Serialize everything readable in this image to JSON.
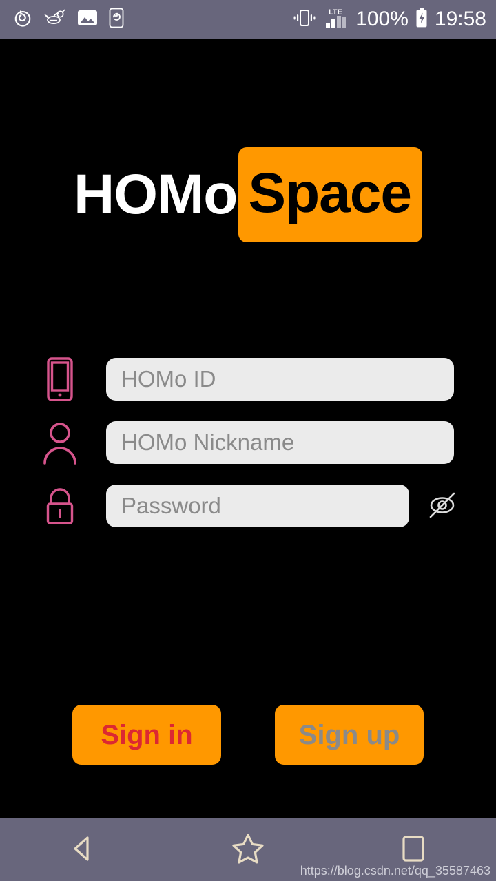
{
  "status_bar": {
    "background": "#68667c",
    "left_icons": [
      {
        "name": "netease-music-icon"
      },
      {
        "name": "bee-icon"
      },
      {
        "name": "gallery-photo-icon"
      },
      {
        "name": "screen-rotate-icon"
      }
    ],
    "right_icons": [
      {
        "name": "vibrate-icon"
      },
      {
        "name": "lte-signal-icon",
        "label": "LTE"
      },
      {
        "name": "battery-charging-icon"
      }
    ],
    "battery_percent": "100%",
    "clock": "19:58"
  },
  "logo": {
    "part_plain": "HOMo",
    "part_highlight": "Space",
    "plain_color": "#ffffff",
    "highlight_bg": "#FF9800",
    "highlight_color": "#000000"
  },
  "form": {
    "fields": [
      {
        "name": "homo-id",
        "icon": "phone-device-icon",
        "placeholder": "HOMo ID",
        "value": ""
      },
      {
        "name": "homo-nickname",
        "icon": "person-icon",
        "placeholder": "HOMo Nickname",
        "value": ""
      },
      {
        "name": "password",
        "icon": "lock-icon",
        "placeholder": "Password",
        "value": ""
      }
    ],
    "icon_color": "#d6548c",
    "input_bg": "#ebebeb",
    "placeholder_color": "#8a8a8a",
    "password_toggle": {
      "icon": "eye-off-icon",
      "state": "hidden"
    }
  },
  "actions": {
    "sign_in_label": "Sign in",
    "sign_in_color": "#dc2832",
    "sign_up_label": "Sign up",
    "sign_up_color": "#8a8a8a",
    "button_bg": "#FF9800"
  },
  "nav_bar": {
    "background": "#68667c",
    "icon_color": "#e8dcc4",
    "buttons": [
      {
        "name": "nav-back-icon"
      },
      {
        "name": "nav-star-home-icon"
      },
      {
        "name": "nav-recents-square-icon"
      }
    ]
  },
  "watermark": {
    "text": "https://blog.csdn.net/qq_35587463"
  }
}
